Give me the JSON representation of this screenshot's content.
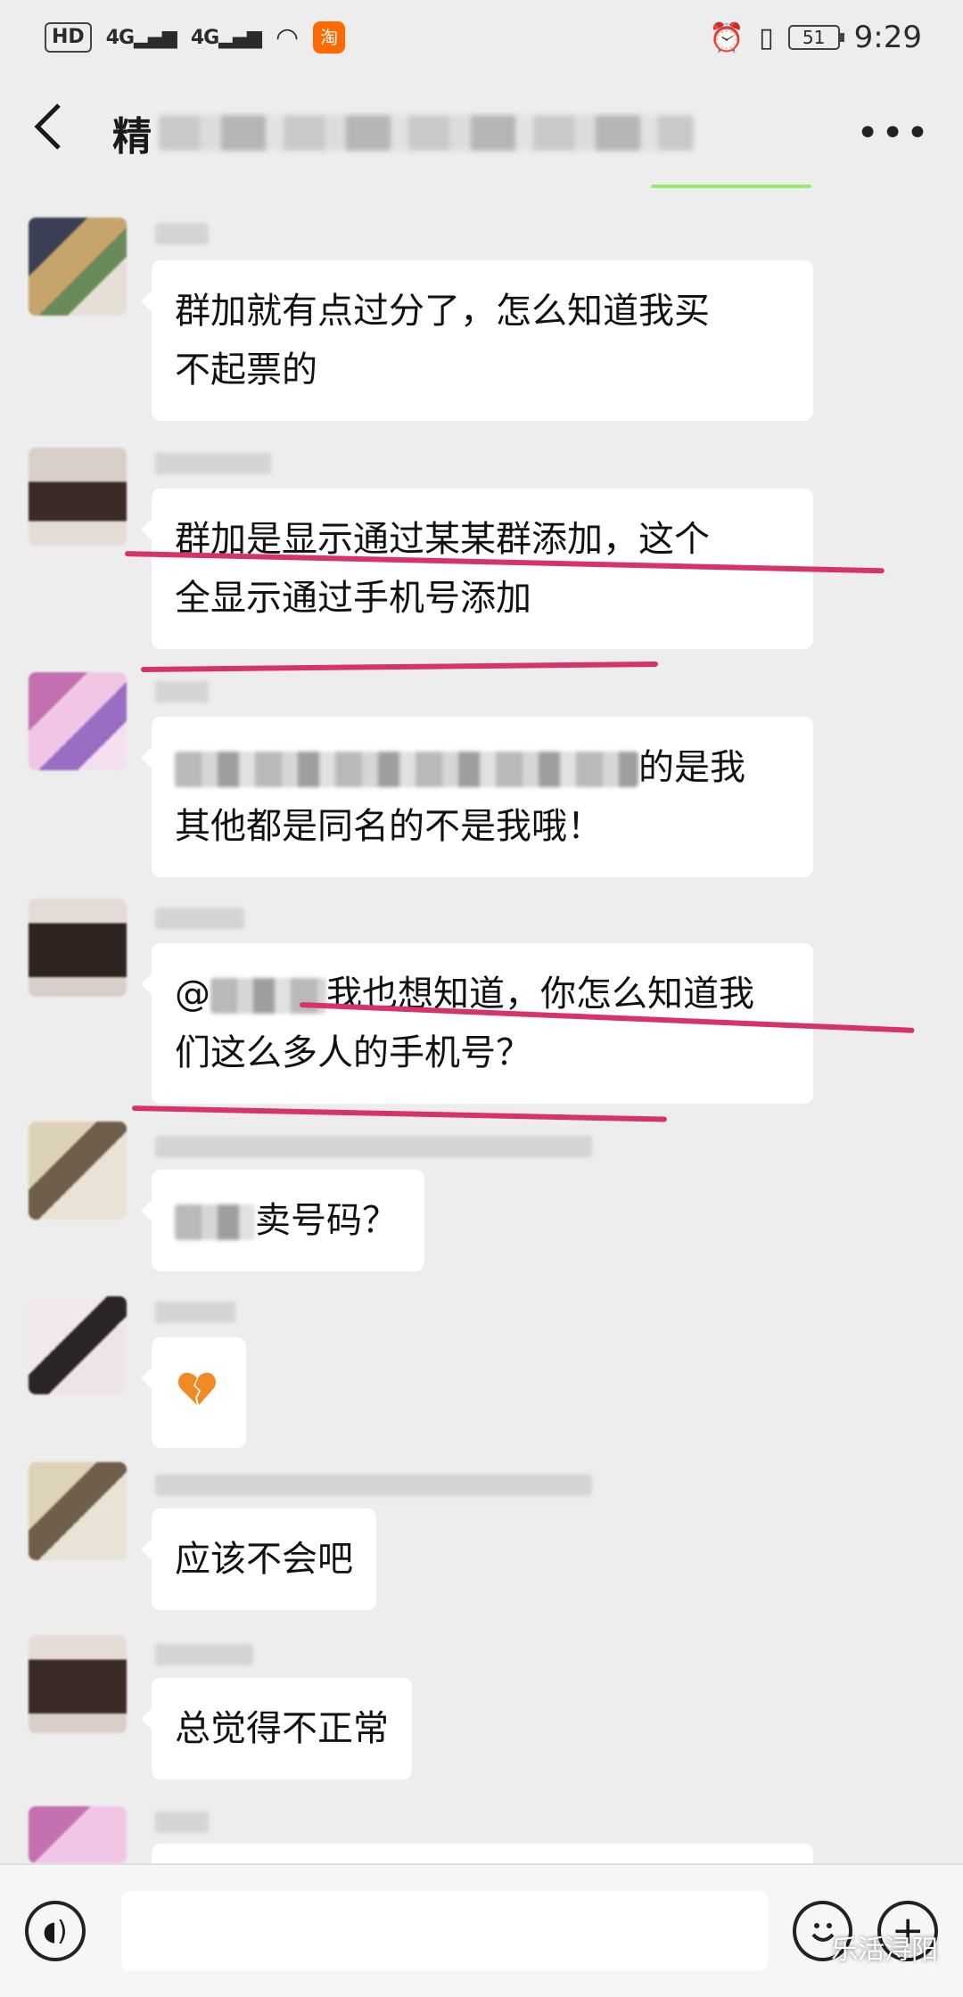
{
  "status_bar": {
    "hd": "HD",
    "net1": "4G",
    "net2": "4G",
    "app_badge": "淘",
    "battery": "51",
    "time": "9:29"
  },
  "header": {
    "back_icon": "back-chevron-icon",
    "title_visible": "精",
    "more_icon": "more-dots-icon"
  },
  "messages": [
    {
      "lines": [
        "群加就有点过分了，怎么知道我买",
        "不起票的"
      ]
    },
    {
      "lines": [
        "群加是显示通过某某群添加，这个",
        "全显示通过手机号添加"
      ]
    },
    {
      "line1_tail": "的是我",
      "line2": "其他都是同名的不是我哦！"
    },
    {
      "line1_tail": "我也想知道，你怎么知道我",
      "line2": "们这么多人的手机号？"
    },
    {
      "tail": "卖号码？"
    },
    {
      "emoji": "broken-heart-icon"
    },
    {
      "text": "应该不会吧"
    },
    {
      "text": "总觉得不正常"
    }
  ],
  "input_bar": {
    "voice_icon": "voice-icon",
    "emoji_icon": "emoji-icon",
    "plus_icon": "plus-icon"
  },
  "watermark": "乐活浔阳",
  "colors": {
    "background": "#ededed",
    "bubble": "#ffffff",
    "underline": "#d6336c",
    "online": "#95ec69"
  }
}
